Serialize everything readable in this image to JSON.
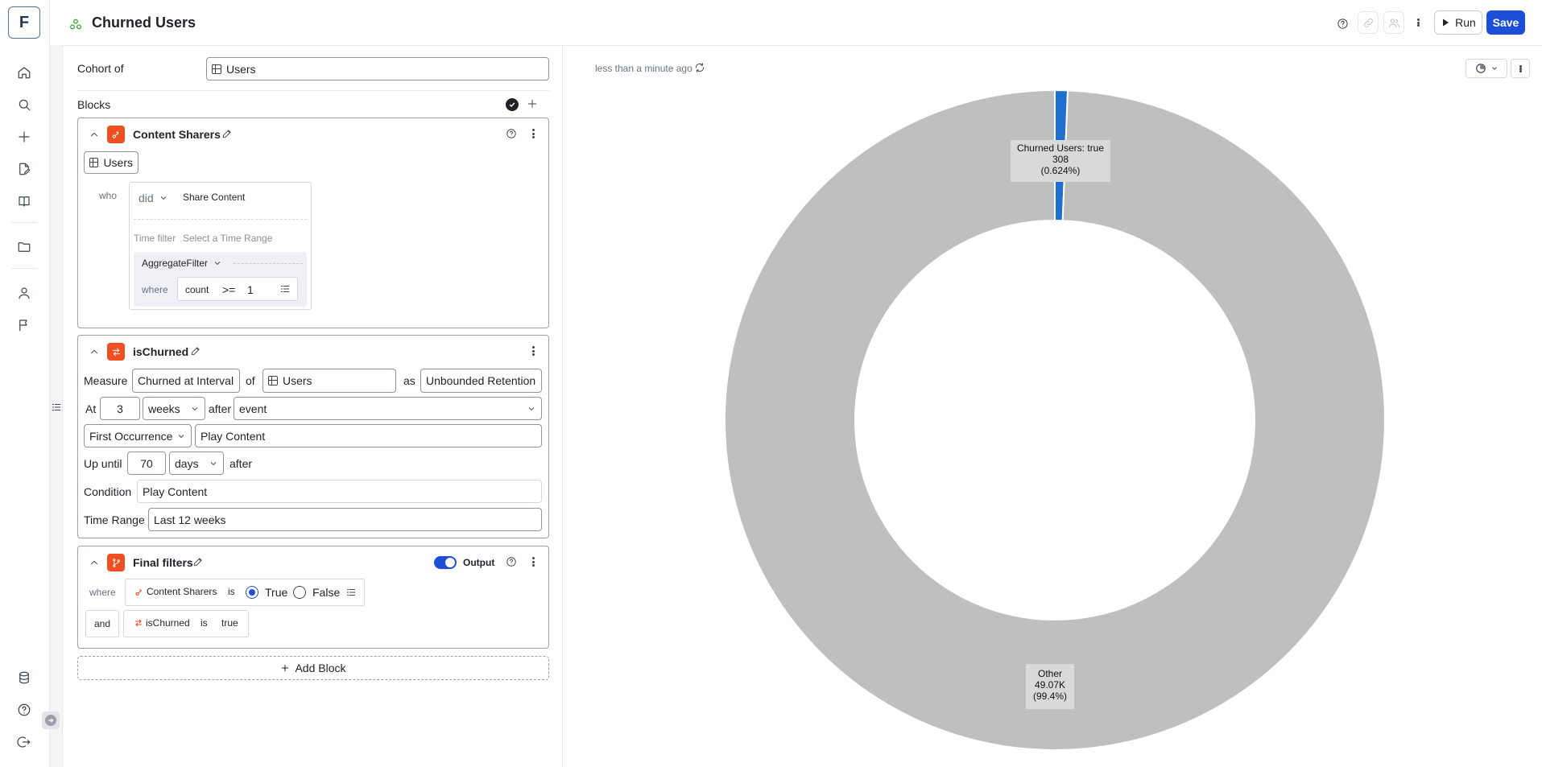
{
  "app": {
    "logo_letter": "F",
    "title": "Churned Users",
    "run_label": "Run",
    "save_label": "Save",
    "accent": "#1d4ed8",
    "block_icon_color": "#f04e23"
  },
  "rail": {
    "icons": [
      "home-icon",
      "search-icon",
      "plus-icon",
      "edit-file-icon",
      "book-icon",
      "folder-icon",
      "user-icon",
      "flag-icon"
    ],
    "bottom_icons": [
      "database-icon",
      "help-icon",
      "logout-icon"
    ]
  },
  "cohort": {
    "label": "Cohort of",
    "value": "Users"
  },
  "blocks_header": "Blocks",
  "block1": {
    "name": "Content Sharers",
    "entity": "Users",
    "who_label": "who",
    "did_value": "did",
    "event": "Share Content",
    "time_filter_label": "Time filter",
    "time_filter_placeholder": "Select a Time Range",
    "aggregate_label": "AggregateFilter",
    "where_label": "where",
    "agg_field": "count",
    "agg_op": ">=",
    "agg_value": "1"
  },
  "block2": {
    "name": "isChurned",
    "measure_label": "Measure",
    "measure_value": "Churned at Interval",
    "of_label": "of",
    "of_value": "Users",
    "as_label": "as",
    "as_value": "Unbounded Retention",
    "at_label": "At",
    "at_value": "3",
    "at_unit": "weeks",
    "after_label": "after",
    "after_value": "event",
    "occurrence": "First Occurrence",
    "occurrence_event": "Play Content",
    "upuntil_label": "Up until",
    "upuntil_value": "70",
    "upuntil_unit": "days",
    "upuntil_after": "after",
    "condition_label": "Condition",
    "condition_value": "Play Content",
    "timerange_label": "Time Range",
    "timerange_value": "Last 12 weeks"
  },
  "block3": {
    "name": "Final filters",
    "output_label": "Output",
    "where_label": "where",
    "filter1_field": "Content Sharers",
    "filter1_is": "is",
    "true_label": "True",
    "false_label": "False",
    "and_label": "and",
    "filter2_field": "isChurned",
    "filter2_is": "is",
    "filter2_value": "true"
  },
  "add_block_label": "Add Block",
  "result": {
    "timestamp": "less than a minute ago"
  },
  "chart_data": {
    "type": "pie",
    "donut": true,
    "slices": [
      {
        "label": "Churned Users: true",
        "value": 308,
        "value_label": "308",
        "percent_label": "(0.624%)",
        "color": "#1f6fd1"
      },
      {
        "label": "Other",
        "value": 49070,
        "value_label": "49.07K",
        "percent_label": "(99.4%)",
        "color": "#bfbfbf"
      }
    ]
  }
}
